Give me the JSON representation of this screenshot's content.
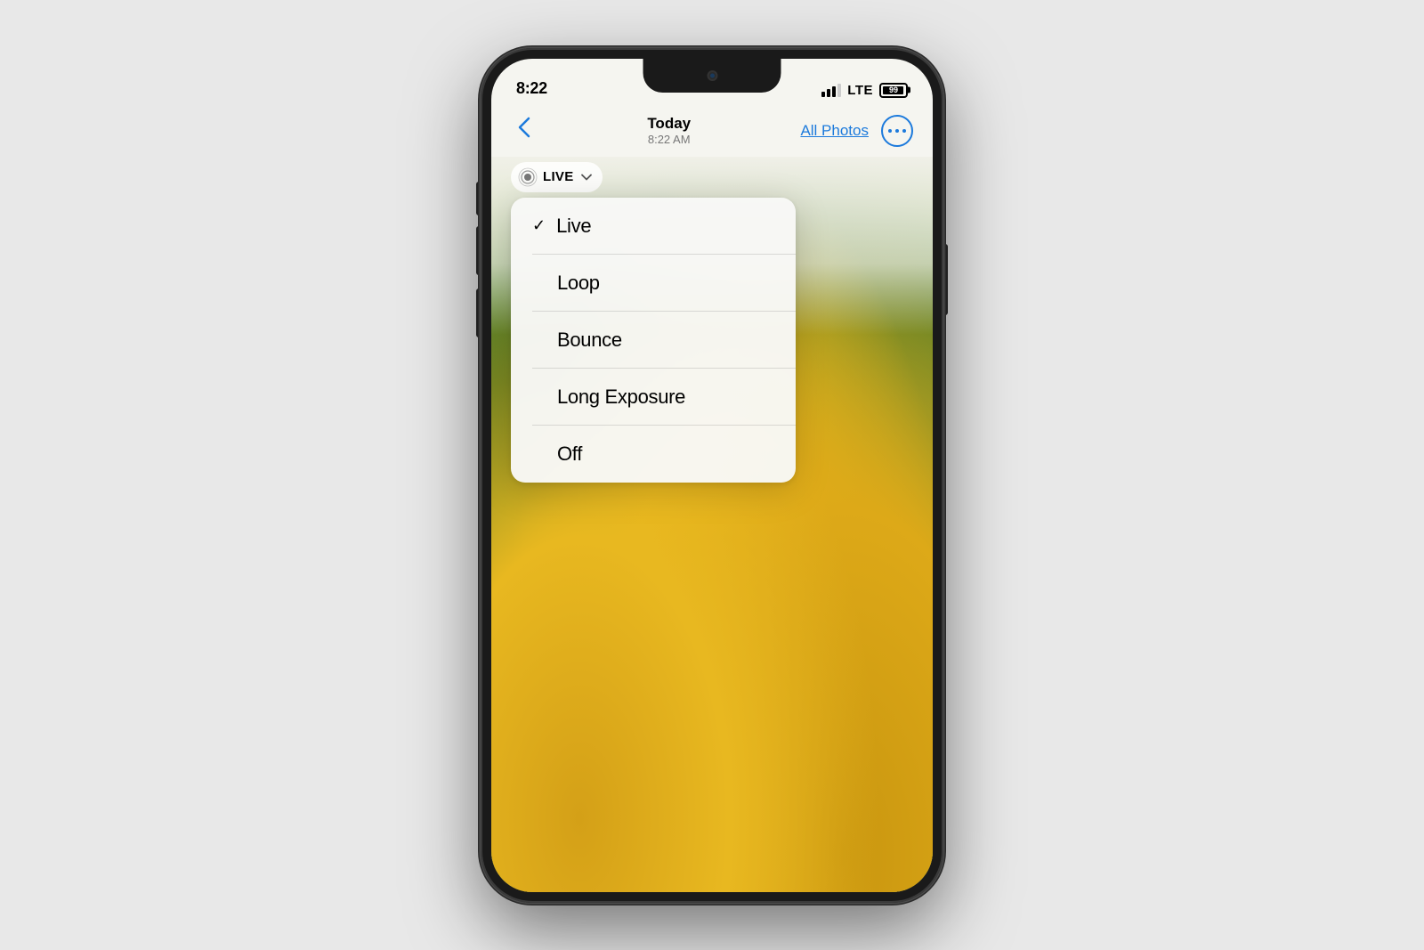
{
  "phone": {
    "status_bar": {
      "time": "8:22",
      "lte_label": "LTE",
      "battery_level": "99"
    },
    "nav": {
      "back_label": "<",
      "title": "Today",
      "subtitle": "8:22 AM",
      "all_photos_label": "All Photos"
    },
    "live_button": {
      "label": "LIVE",
      "chevron": "∨"
    },
    "dropdown": {
      "items": [
        {
          "id": "live",
          "label": "Live",
          "checked": true
        },
        {
          "id": "loop",
          "label": "Loop",
          "checked": false
        },
        {
          "id": "bounce",
          "label": "Bounce",
          "checked": false
        },
        {
          "id": "long-exposure",
          "label": "Long Exposure",
          "checked": false
        },
        {
          "id": "off",
          "label": "Off",
          "checked": false
        }
      ]
    },
    "colors": {
      "accent": "#1c7adc",
      "text_primary": "#000000",
      "background": "#f5f5f0"
    }
  }
}
